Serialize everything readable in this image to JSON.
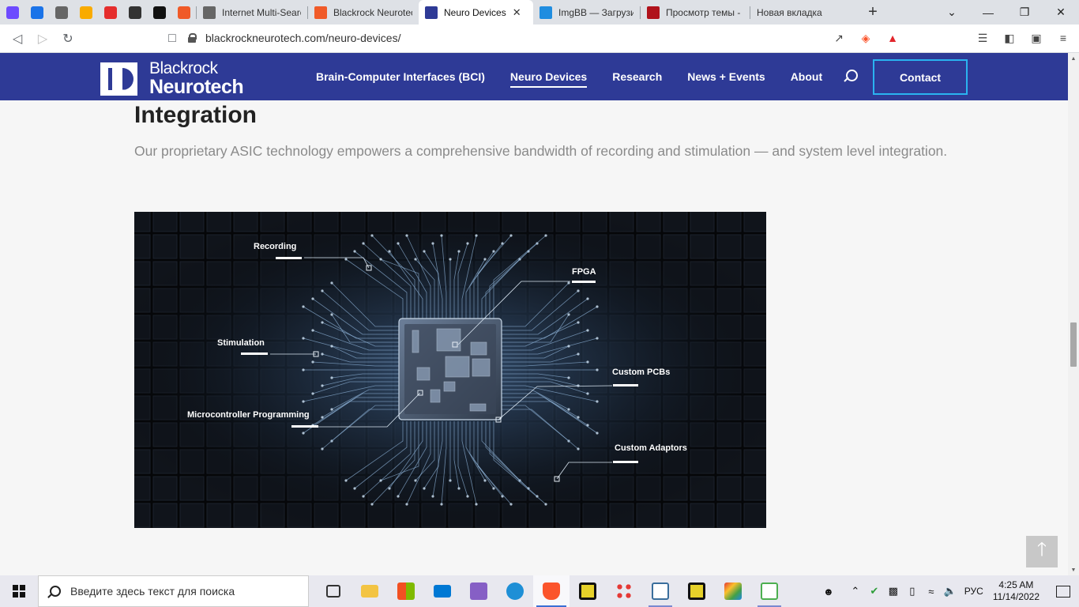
{
  "browser": {
    "tabs": [
      {
        "title": "",
        "favicon": "proton-mail-icon",
        "color": "#6d4aff",
        "pinned": true
      },
      {
        "title": "",
        "favicon": "mail-icon",
        "color": "#1a73e8",
        "pinned": true
      },
      {
        "title": "",
        "favicon": "globe-icon",
        "color": "#666666",
        "pinned": true
      },
      {
        "title": "",
        "favicon": "analytics-icon",
        "color": "#f9ab00",
        "pinned": true
      },
      {
        "title": "",
        "favicon": "sberbank-icon",
        "color": "#e52d2d",
        "pinned": true
      },
      {
        "title": "",
        "favicon": "audio-icon",
        "color": "#333333",
        "pinned": true
      },
      {
        "title": "",
        "favicon": "wikipedia-icon",
        "color": "#111111",
        "pinned": true
      },
      {
        "title": "",
        "favicon": "plus-cross-icon",
        "color": "#f05a28",
        "pinned": true
      },
      {
        "title": "Internet Multi-Searc",
        "favicon": "globe-icon",
        "color": "#666666"
      },
      {
        "title": "Blackrock Neurotec",
        "favicon": "plus-cross-icon",
        "color": "#f05a28"
      },
      {
        "title": "Neuro Devices",
        "favicon": "page-icon",
        "color": "#2e3a96",
        "active": true
      },
      {
        "title": "ImgBB — Загрузить",
        "favicon": "imgbb-icon",
        "color": "#1f8de0"
      },
      {
        "title": "Просмотр темы - С",
        "favicon": "forum-icon",
        "color": "#b0121b"
      },
      {
        "title": "Новая вкладка",
        "favicon": "",
        "color": "#dee1e6"
      }
    ],
    "address": "blackrockneurotech.com/neuro-devices/",
    "shield_count": "2"
  },
  "site": {
    "logo_line1": "Blackrock",
    "logo_line2": "Neurotech",
    "nav": [
      {
        "label": "Brain-Computer Interfaces (BCI)",
        "current": false
      },
      {
        "label": "Neuro Devices",
        "current": true
      },
      {
        "label": "Research",
        "current": false
      },
      {
        "label": "News + Events",
        "current": false
      },
      {
        "label": "About",
        "current": false
      }
    ],
    "contact_label": "Contact",
    "brand_color": "#2e3a96",
    "accent_color": "#2ab3f0"
  },
  "content": {
    "heading": "Integration",
    "lead": "Our proprietary ASIC technology empowers a comprehensive bandwidth of recording and stimulation — and system level integration.",
    "figure_labels": {
      "recording": "Recording",
      "fpga": "FPGA",
      "stimulation": "Stimulation",
      "custom_pcbs": "Custom PCBs",
      "micro": "Microcontroller Programming",
      "adaptors": "Custom Adaptors"
    }
  },
  "taskbar": {
    "search_placeholder": "Введите здесь текст для поиска",
    "language": "РУС",
    "time": "4:25 AM",
    "date": "11/14/2022"
  }
}
